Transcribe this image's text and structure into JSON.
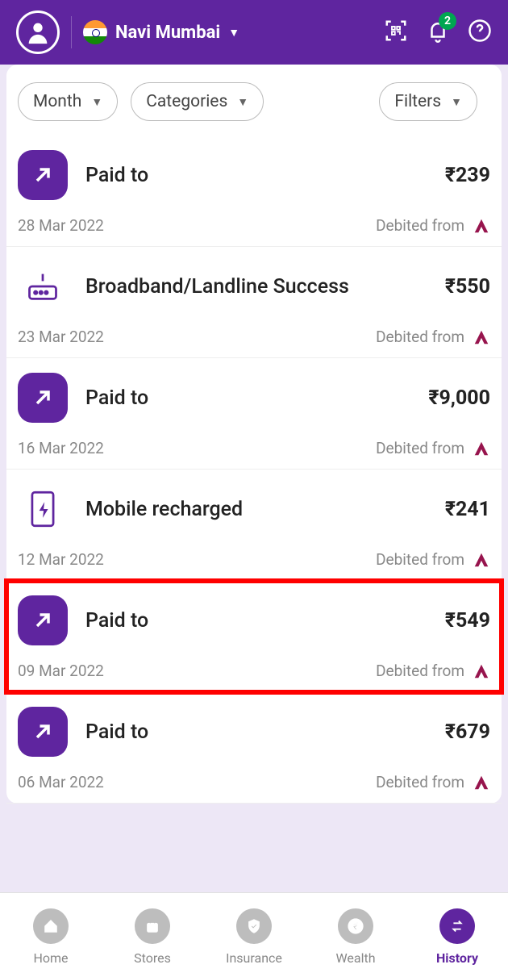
{
  "header": {
    "location": "Navi Mumbai",
    "notification_count": "2"
  },
  "filters": {
    "month": "Month",
    "categories": "Categories",
    "filters": "Filters"
  },
  "transactions": [
    {
      "icon": "arrow",
      "title": "Paid to",
      "amount": "₹239",
      "date": "28 Mar 2022",
      "source": "Debited from",
      "bank": "axis",
      "highlight": false
    },
    {
      "icon": "router",
      "title": "Broadband/Landline Success",
      "amount": "₹550",
      "date": "23 Mar 2022",
      "source": "Debited from",
      "bank": "axis",
      "highlight": false
    },
    {
      "icon": "arrow",
      "title": "Paid to",
      "amount": "₹9,000",
      "date": "16 Mar 2022",
      "source": "Debited from",
      "bank": "axis",
      "highlight": false
    },
    {
      "icon": "mobile",
      "title": "Mobile recharged",
      "amount": "₹241",
      "date": "12 Mar 2022",
      "source": "Debited from",
      "bank": "axis",
      "highlight": false
    },
    {
      "icon": "arrow",
      "title": "Paid to",
      "amount": "₹549",
      "date": "09 Mar 2022",
      "source": "Debited from",
      "bank": "axis",
      "highlight": true
    },
    {
      "icon": "arrow",
      "title": "Paid to",
      "amount": "₹679",
      "date": "06 Mar 2022",
      "source": "Debited from",
      "bank": "axis",
      "highlight": false
    }
  ],
  "nav": {
    "home": "Home",
    "stores": "Stores",
    "insurance": "Insurance",
    "wealth": "Wealth",
    "history": "History"
  }
}
